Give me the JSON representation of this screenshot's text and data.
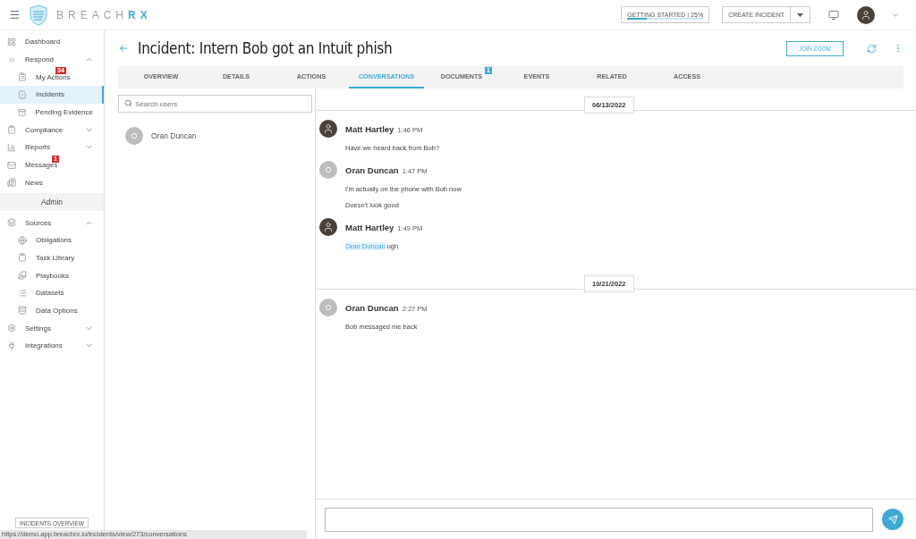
{
  "header": {
    "brand": "BREACH",
    "brand_accent": "RX",
    "getting_started": {
      "label": "GETTING STARTED | 25%",
      "level": 0.25
    },
    "create_button": "CREATE INCIDENT"
  },
  "sidebar": {
    "items": [
      {
        "label": "Dashboard",
        "kind": "link",
        "selected": false
      },
      {
        "label": "Respond",
        "kind": "group",
        "expanded": true,
        "selected": false,
        "children": [
          {
            "label": "My Actions",
            "selected": false,
            "badge": "34"
          },
          {
            "label": "Incidents",
            "selected": true
          },
          {
            "label": "Pending Evidence",
            "selected": false
          }
        ]
      },
      {
        "label": "Compliance",
        "kind": "group",
        "expanded": false,
        "selected": false
      },
      {
        "label": "Reports",
        "kind": "group",
        "expanded": false,
        "selected": false
      },
      {
        "label": "Messages",
        "kind": "link",
        "selected": false,
        "badge": "1"
      },
      {
        "label": "News",
        "kind": "link",
        "selected": false
      }
    ],
    "admin": {
      "title": "Admin",
      "items": [
        {
          "label": "Sources",
          "kind": "group",
          "expanded": true,
          "selected": false,
          "children": [
            {
              "label": "Obligations",
              "selected": false
            },
            {
              "label": "Task Library",
              "selected": false
            },
            {
              "label": "Playbooks",
              "selected": false
            },
            {
              "label": "Datasets",
              "selected": false
            },
            {
              "label": "Data Options",
              "selected": false
            }
          ]
        },
        {
          "label": "Settings",
          "kind": "group",
          "expanded": false,
          "selected": false
        },
        {
          "label": "Integrations",
          "kind": "group",
          "expanded": false,
          "selected": false
        }
      ]
    },
    "footer_button": "INCIDENTS OVERVIEW"
  },
  "page": {
    "title": "Incident: Intern Bob got an Intuit phish",
    "join_button": "JOIN ZOOM"
  },
  "tabs": [
    {
      "label": "OVERVIEW",
      "selected": false
    },
    {
      "label": "DETAILS",
      "selected": false
    },
    {
      "label": "ACTIONS",
      "selected": false
    },
    {
      "label": "CONVERSATIONS",
      "selected": true
    },
    {
      "label": "DOCUMENTS",
      "selected": false,
      "badge": "1"
    },
    {
      "label": "EVENTS",
      "selected": false
    },
    {
      "label": "RELATED",
      "selected": false
    },
    {
      "label": "ACCESS",
      "selected": false
    }
  ],
  "users": {
    "search": {
      "placeholder": "Search users"
    },
    "list": [
      {
        "initial": "O",
        "name": "Oran Duncan"
      }
    ]
  },
  "conversation": {
    "days": [
      {
        "date": "06/13/2022",
        "messages": [
          {
            "author": "Matt Hartley",
            "time": "1:46 PM",
            "lines": [
              {
                "text": "Have we heard back from Bob?"
              }
            ]
          },
          {
            "author": "Oran Duncan",
            "initial": "O",
            "time": "1:47 PM",
            "lines": [
              {
                "text": "I'm actually on the phone with Bob now"
              },
              {
                "text": "Doesn't look good"
              }
            ]
          },
          {
            "author": "Matt Hartley",
            "time": "1:49 PM",
            "lines": [
              {
                "mention": "Oran Duncan",
                "text": "ugh"
              }
            ]
          }
        ]
      },
      {
        "date": "10/21/2022",
        "messages": [
          {
            "author": "Oran Duncan",
            "initial": "O",
            "time": "2:27 PM",
            "lines": [
              {
                "text": "Bob messaged me back"
              }
            ]
          }
        ]
      }
    ]
  },
  "status_bar": {
    "url": "https://demo.app.breachrx.io/incidents/view/273/conversations"
  }
}
